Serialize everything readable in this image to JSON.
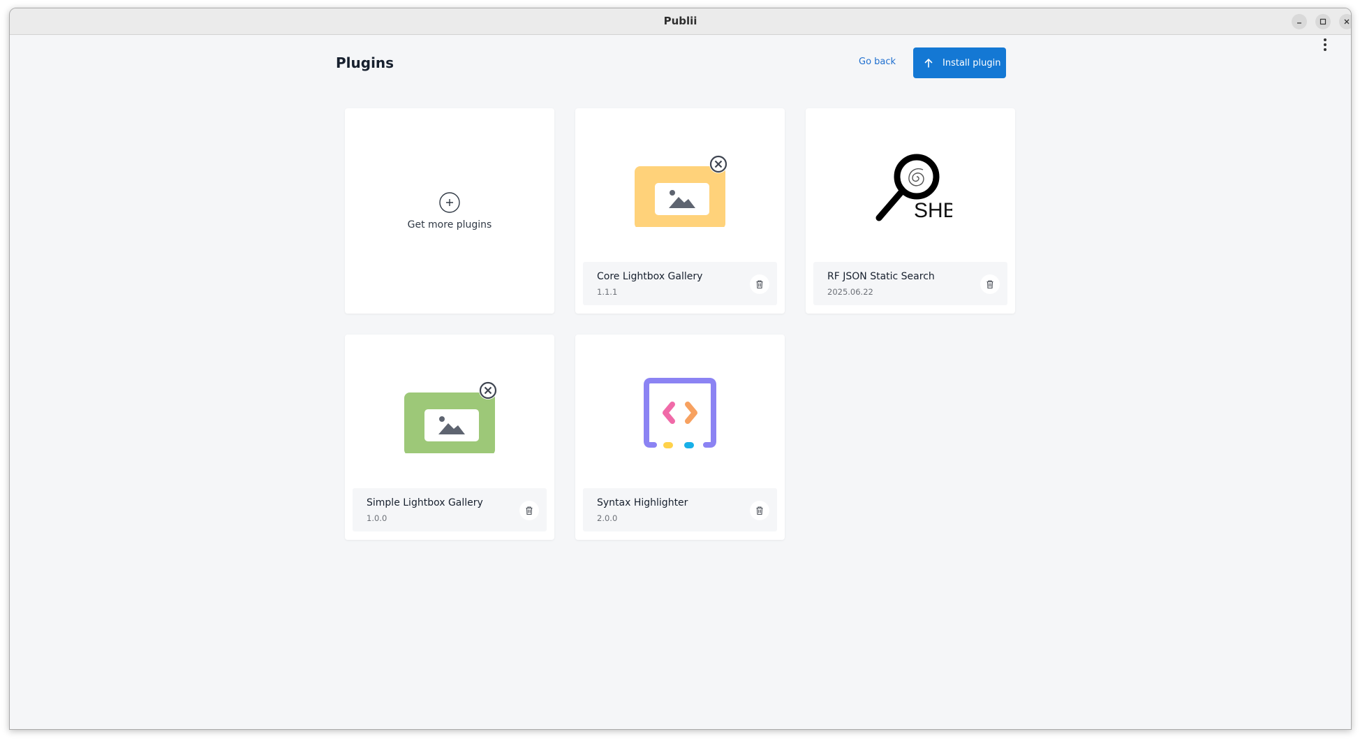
{
  "window": {
    "title": "Publii"
  },
  "header": {
    "title": "Plugins",
    "go_back_label": "Go back",
    "install_label": "Install plugin"
  },
  "get_more": {
    "label": "Get more plugins"
  },
  "plugins": [
    {
      "name": "Core Lightbox Gallery",
      "version": "1.1.1",
      "icon": "yellow-gallery-icon",
      "color": "#ffd27a"
    },
    {
      "name": "RF JSON Static Search",
      "version": "2025.06.22",
      "icon": "shb-search-logo",
      "logo_text": "SHB"
    },
    {
      "name": "Simple Lightbox Gallery",
      "version": "1.0.0",
      "icon": "green-gallery-icon",
      "color": "#9dc878"
    },
    {
      "name": "Syntax Highlighter",
      "version": "2.0.0",
      "icon": "code-brackets-icon",
      "color": "#8b83f3"
    }
  ],
  "colors": {
    "accent": "#1478d4",
    "background": "#f5f6f8"
  }
}
